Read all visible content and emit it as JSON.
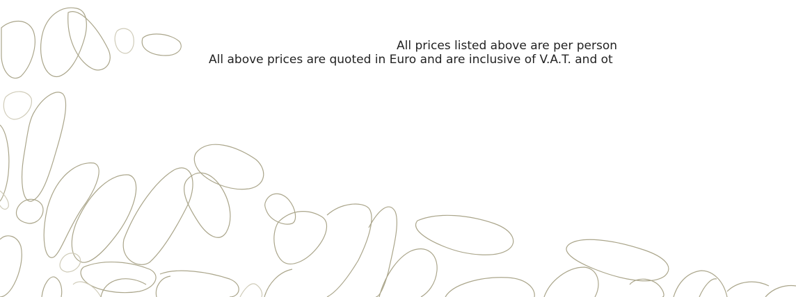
{
  "notes": {
    "per_person": "All prices listed above are per person",
    "currency": "All above prices are quoted in Euro and are inclusive of V.A.T. and ot"
  },
  "colors": {
    "background": "#ffffff",
    "text": "#222222",
    "pebble_stroke": "#aaa58a",
    "pebble_stroke_light": "#cfcbb8"
  },
  "decoration": {
    "icon": "pebble-pattern-icon"
  }
}
